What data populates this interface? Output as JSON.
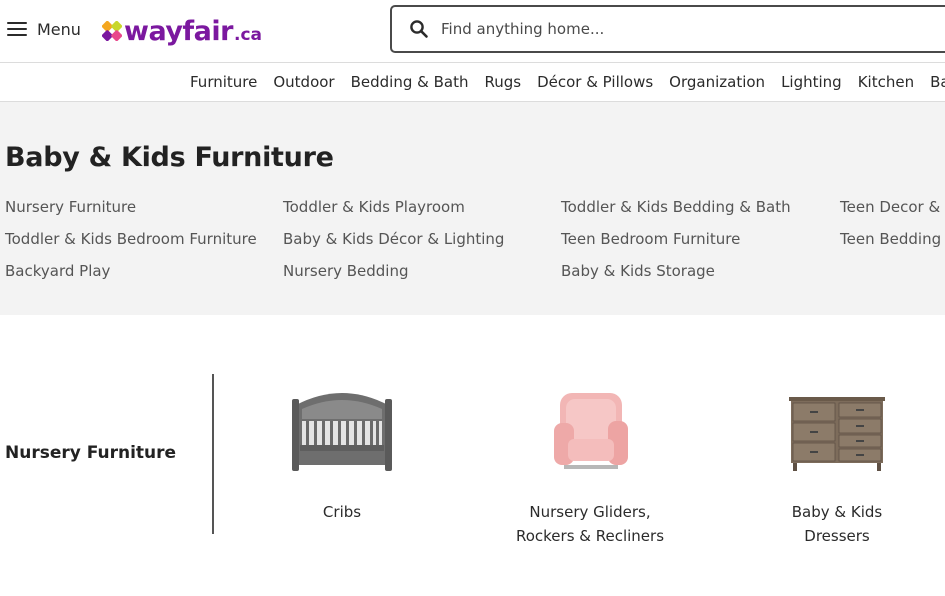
{
  "header": {
    "menu_label": "Menu",
    "logo_text": "wayfair",
    "logo_tld": ".ca",
    "search": {
      "placeholder": "Find anything home..."
    },
    "brand_color": "#7b189f"
  },
  "nav": {
    "items": [
      "Furniture",
      "Outdoor",
      "Bedding & Bath",
      "Rugs",
      "Décor & Pillows",
      "Organization",
      "Lighting",
      "Kitchen",
      "Baby"
    ]
  },
  "hero": {
    "title": "Baby & Kids Furniture",
    "links": [
      "Nursery Furniture",
      "Toddler & Kids Playroom",
      "Toddler & Kids Bedding & Bath",
      "Teen Decor & Lighting",
      "Toddler & Kids Bedroom Furniture",
      "Baby & Kids Décor & Lighting",
      "Teen Bedroom Furniture",
      "Teen Bedding",
      "Backyard Play",
      "Nursery Bedding",
      "Baby & Kids Storage"
    ]
  },
  "section": {
    "title": "Nursery Furniture",
    "products": [
      {
        "label": "Cribs",
        "icon": "crib-image"
      },
      {
        "label": "Nursery Gliders,\nRockers & Recliners",
        "icon": "glider-image"
      },
      {
        "label": "Baby & Kids\nDressers",
        "icon": "dresser-image"
      }
    ]
  }
}
